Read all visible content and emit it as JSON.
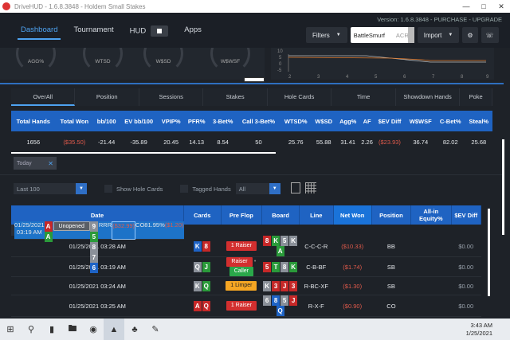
{
  "window": {
    "title": "DriveHUD - 1.6.8.3848 - Holdem Small Stakes"
  },
  "header": {
    "version": "Version: 1.6.8.3848 - PURCHASE - UPGRADE",
    "nav": [
      "Dashboard",
      "Tournament",
      "HUD",
      "Apps"
    ],
    "filters_label": "Filters",
    "player_name": "BattleSmurf",
    "player_site": "ACR",
    "import_label": "Import"
  },
  "gauges": [
    "AGG%",
    "WTSD",
    "W$SD",
    "W$WSF"
  ],
  "minichart": {
    "y_ticks": [
      "10",
      "5",
      "0",
      "-5"
    ],
    "x_ticks": [
      "2",
      "3",
      "4",
      "5",
      "6",
      "7",
      "8",
      "9"
    ]
  },
  "subtabs": [
    "OverAll",
    "Position",
    "Sessions",
    "Stakes",
    "Hole Cards",
    "Time",
    "Showdown Hands",
    "Poke"
  ],
  "stats": {
    "headers": [
      "Total Hands",
      "Total Won",
      "bb/100",
      "EV bb/100",
      "VPIP%",
      "PFR%",
      "3-Bet%",
      "Call 3-Bet%",
      "WTSD%",
      "W$SD",
      "Agg%",
      "AF",
      "$EV Diff",
      "W$WSF",
      "C-Bet%",
      "Steal%"
    ],
    "values": [
      "1656",
      "($35.50)",
      "-21.44",
      "-35.89",
      "20.45",
      "14.13",
      "8.54",
      "50",
      "25.76",
      "55.88",
      "31.41",
      "2.26",
      "($23.93)",
      "36.74",
      "82.02",
      "25.68"
    ]
  },
  "filter_chip": "Today",
  "controls": {
    "range": "Last 100",
    "show_hole_cards": "Show Hole Cards",
    "tagged_hands": "Tagged Hands",
    "tagged_value": "All"
  },
  "hands": {
    "headers": [
      "Date",
      "Cards",
      "Pre Flop",
      "Board",
      "Line",
      "Net Won",
      "Position",
      "All-in Equity%",
      "$EV Diff"
    ],
    "rows": [
      {
        "date": "01/25/2021 03:19 AM",
        "cards": [
          {
            "r": "A",
            "c": "red"
          },
          {
            "r": "A",
            "c": "green"
          }
        ],
        "preflop": [
          {
            "t": "Unopened",
            "k": "unopened"
          }
        ],
        "board": [
          {
            "r": "9",
            "c": "gray"
          },
          {
            "r": "5",
            "c": "green"
          },
          {
            "r": "8",
            "c": "gray"
          },
          {
            "r": "7",
            "c": "gray"
          },
          {
            "r": "6",
            "c": "blue"
          }
        ],
        "line": "RRR",
        "net": "($32.99)",
        "pos": "CO",
        "equity": "81.95%",
        "ev": "($1.20)",
        "selected": true
      },
      {
        "date": "01/25/2021 03:28 AM",
        "cards": [
          {
            "r": "K",
            "c": "blue"
          },
          {
            "r": "8",
            "c": "red"
          }
        ],
        "preflop": [
          {
            "t": "1 Raiser",
            "k": "raiser"
          }
        ],
        "board": [
          {
            "r": "8",
            "c": "red"
          },
          {
            "r": "K",
            "c": "green"
          },
          {
            "r": "5",
            "c": "gray"
          },
          {
            "r": "K",
            "c": "gray"
          },
          {
            "r": "A",
            "c": "green"
          }
        ],
        "line": "C-C-C-R",
        "net": "($10.33)",
        "pos": "BB",
        "equity": "",
        "ev": "$0.00"
      },
      {
        "date": "01/25/2021 03:19 AM",
        "cards": [
          {
            "r": "Q",
            "c": "gray"
          },
          {
            "r": "J",
            "c": "green"
          }
        ],
        "preflop": [
          {
            "t": "Raiser",
            "k": "raiser"
          },
          {
            "t": "Caller",
            "k": "caller"
          }
        ],
        "board": [
          {
            "r": "5",
            "c": "red"
          },
          {
            "r": "T",
            "c": "green"
          },
          {
            "r": "8",
            "c": "gray"
          },
          {
            "r": "K",
            "c": "green"
          }
        ],
        "line": "C-B-BF",
        "net": "($1.74)",
        "pos": "SB",
        "equity": "",
        "ev": "$0.00"
      },
      {
        "date": "01/25/2021 03:24 AM",
        "cards": [
          {
            "r": "K",
            "c": "gray"
          },
          {
            "r": "Q",
            "c": "green"
          }
        ],
        "preflop": [
          {
            "t": "1 Limper",
            "k": "limper"
          }
        ],
        "board": [
          {
            "r": "K",
            "c": "gray"
          },
          {
            "r": "3",
            "c": "red"
          },
          {
            "r": "J",
            "c": "red"
          },
          {
            "r": "3",
            "c": "red"
          }
        ],
        "line": "R-BC-XF",
        "net": "($1.30)",
        "pos": "SB",
        "equity": "",
        "ev": "$0.00"
      },
      {
        "date": "01/25/2021 03:25 AM",
        "cards": [
          {
            "r": "A",
            "c": "red"
          },
          {
            "r": "Q",
            "c": "red"
          }
        ],
        "preflop": [
          {
            "t": "1 Raiser",
            "k": "raiser"
          }
        ],
        "board": [
          {
            "r": "6",
            "c": "gray"
          },
          {
            "r": "8",
            "c": "blue"
          },
          {
            "r": "5",
            "c": "gray"
          },
          {
            "r": "J",
            "c": "red"
          },
          {
            "r": "Q",
            "c": "blue"
          }
        ],
        "line": "R-X-F",
        "net": "($0.90)",
        "pos": "CO",
        "equity": "",
        "ev": "$0.00"
      }
    ]
  },
  "taskbar": {
    "time": "3:43 AM",
    "date": "1/25/2021"
  }
}
